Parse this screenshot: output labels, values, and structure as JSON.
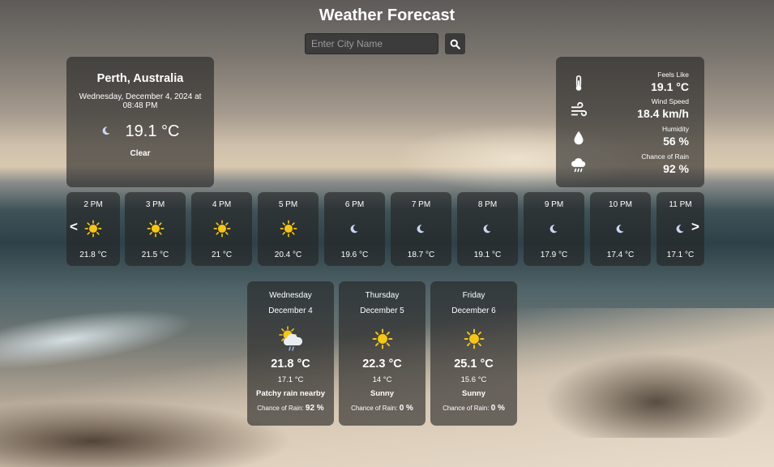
{
  "app": {
    "title": "Weather Forecast"
  },
  "search": {
    "placeholder": "Enter City Name"
  },
  "current": {
    "city": "Perth, Australia",
    "datetime": "Wednesday, December 4, 2024 at 08:48 PM",
    "temperature": "19.1 °C",
    "condition": "Clear",
    "icon": "moon-icon"
  },
  "details": {
    "feels_like_label": "Feels Like",
    "feels_like": "19.1 °C",
    "wind_label": "Wind Speed",
    "wind": "18.4 km/h",
    "humidity_label": "Humidity",
    "humidity": "56 %",
    "rain_label": "Chance of Rain",
    "rain": "92 %"
  },
  "hourly": [
    {
      "time": "2 PM",
      "temp": "21.8 °C",
      "icon": "sun-icon"
    },
    {
      "time": "3 PM",
      "temp": "21.5 °C",
      "icon": "sun-icon"
    },
    {
      "time": "4 PM",
      "temp": "21 °C",
      "icon": "sun-icon"
    },
    {
      "time": "5 PM",
      "temp": "20.4 °C",
      "icon": "sun-icon"
    },
    {
      "time": "6 PM",
      "temp": "19.6 °C",
      "icon": "moon-icon"
    },
    {
      "time": "7 PM",
      "temp": "18.7 °C",
      "icon": "moon-icon"
    },
    {
      "time": "8 PM",
      "temp": "19.1 °C",
      "icon": "moon-icon"
    },
    {
      "time": "9 PM",
      "temp": "17.9 °C",
      "icon": "moon-icon"
    },
    {
      "time": "10 PM",
      "temp": "17.4 °C",
      "icon": "moon-icon"
    },
    {
      "time": "11 PM",
      "temp": "17.1 °C",
      "icon": "moon-icon"
    }
  ],
  "nav": {
    "prev": "<",
    "next": ">"
  },
  "daily": [
    {
      "day": "Wednesday",
      "date": "December 4",
      "high": "21.8 °C",
      "low": "17.1 °C",
      "condition": "Patchy rain nearby",
      "rain_label": "Chance of Rain:",
      "rain": "92 %",
      "icon": "rain-cloud-sun-icon"
    },
    {
      "day": "Thursday",
      "date": "December 5",
      "high": "22.3 °C",
      "low": "14 °C",
      "condition": "Sunny",
      "rain_label": "Chance of Rain:",
      "rain": "0 %",
      "icon": "sun-icon"
    },
    {
      "day": "Friday",
      "date": "December 6",
      "high": "25.1 °C",
      "low": "15.6 °C",
      "condition": "Sunny",
      "rain_label": "Chance of Rain:",
      "rain": "0 %",
      "icon": "sun-icon"
    }
  ],
  "colors": {
    "sun": "#f5c518",
    "moon": "#c9d6f0",
    "panel": "#232323"
  }
}
